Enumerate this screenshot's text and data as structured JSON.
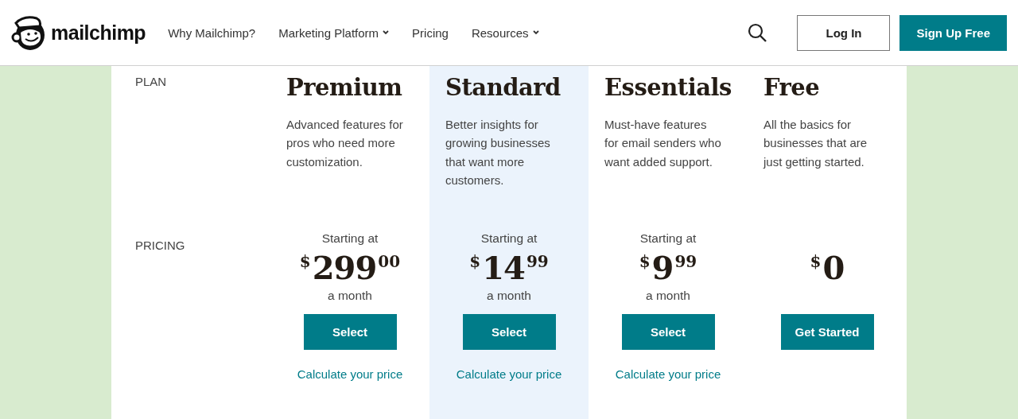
{
  "header": {
    "logo_text": "mailchimp",
    "nav": [
      {
        "label": "Why Mailchimp?",
        "has_menu": false
      },
      {
        "label": "Marketing Platform",
        "has_menu": true
      },
      {
        "label": "Pricing",
        "has_menu": false
      },
      {
        "label": "Resources",
        "has_menu": true
      }
    ],
    "buttons": [
      {
        "label": "Log In",
        "kind": "outline"
      },
      {
        "label": "Sign Up Free",
        "kind": "filled"
      }
    ]
  },
  "table": {
    "row_labels": [
      "PLAN",
      "PRICING"
    ],
    "plans": [
      {
        "name": "Premium",
        "highlighted": false,
        "description": "Advanced features for pros who need more customization.",
        "starting": "Starting at",
        "currency": "$",
        "amount": "299",
        "cents": "00",
        "period": "a month",
        "button": "Select",
        "link": "Calculate your price"
      },
      {
        "name": "Standard",
        "highlighted": true,
        "description": "Better insights for growing businesses that want more customers.",
        "starting": "Starting at",
        "currency": "$",
        "amount": "14",
        "cents": "99",
        "period": "a month",
        "button": "Select",
        "link": "Calculate your price"
      },
      {
        "name": "Essentials",
        "highlighted": false,
        "description": "Must-have features for email senders who want added support.",
        "starting": "Starting at",
        "currency": "$",
        "amount": "9",
        "cents": "99",
        "period": "a month",
        "button": "Select",
        "link": "Calculate your price"
      },
      {
        "name": "Free",
        "highlighted": false,
        "description": "All the basics for businesses that are just getting started.",
        "currency": "$",
        "amount": "0",
        "button": "Get Started"
      }
    ]
  }
}
